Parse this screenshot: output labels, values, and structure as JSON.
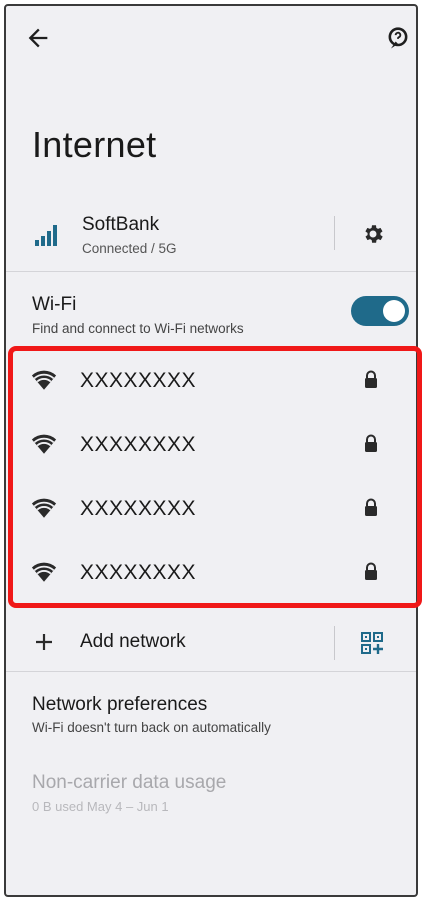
{
  "header": {
    "back_icon": "arrow-back-icon",
    "help_icon": "help-feedback-icon",
    "title": "Internet"
  },
  "mobile_network": {
    "icon": "cell-signal-icon",
    "name": "SoftBank",
    "status": "Connected / 5G",
    "settings_icon": "gear-icon"
  },
  "wifi": {
    "title": "Wi-Fi",
    "subtitle": "Find and connect to Wi-Fi networks",
    "enabled": true,
    "toggle_color": "#1f6a8a"
  },
  "networks": [
    {
      "name": "XXXXXXXX",
      "secured": true
    },
    {
      "name": "XXXXXXXX",
      "secured": true
    },
    {
      "name": "XXXXXXXX",
      "secured": true
    },
    {
      "name": "XXXXXXXX",
      "secured": true
    }
  ],
  "add_network": {
    "label": "Add network",
    "icon": "plus-icon",
    "qr_icon": "qr-code-scan-icon"
  },
  "preferences": {
    "title": "Network preferences",
    "subtitle": "Wi-Fi doesn't turn back on automatically"
  },
  "non_carrier": {
    "title": "Non-carrier data usage",
    "subtitle": "0 B used May 4 – Jun 1"
  },
  "highlight_color": "#f01818"
}
